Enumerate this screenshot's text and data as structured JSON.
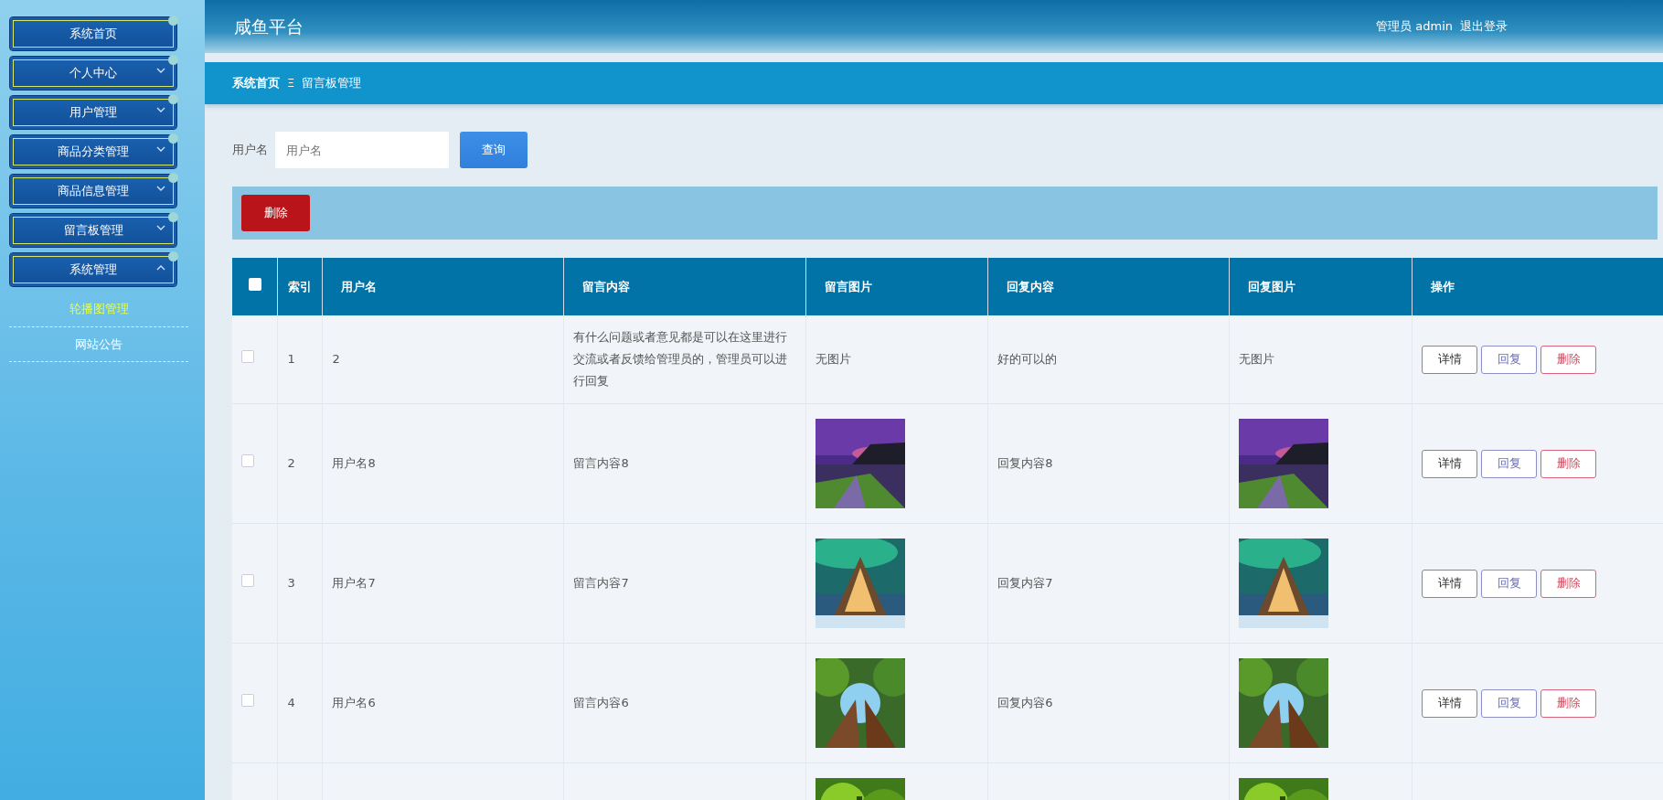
{
  "sidebar": {
    "items": [
      {
        "label": "系统首页",
        "kind": "link"
      },
      {
        "label": "个人中心",
        "kind": "group",
        "expanded": false
      },
      {
        "label": "用户管理",
        "kind": "group",
        "expanded": false
      },
      {
        "label": "商品分类管理",
        "kind": "group",
        "expanded": false
      },
      {
        "label": "商品信息管理",
        "kind": "group",
        "expanded": false
      },
      {
        "label": "留言板管理",
        "kind": "group",
        "expanded": false
      },
      {
        "label": "系统管理",
        "kind": "group",
        "expanded": true,
        "children": [
          {
            "label": "轮播图管理",
            "selected": true
          },
          {
            "label": "网站公告",
            "selected": false
          }
        ]
      }
    ]
  },
  "header": {
    "title": "咸鱼平台",
    "user": "管理员 admin",
    "logout": "退出登录"
  },
  "breadcrumb": {
    "items": [
      "系统首页",
      "留言板管理"
    ],
    "separator": "Ξ"
  },
  "search": {
    "label": "用户名",
    "placeholder": "用户名",
    "button": "查询"
  },
  "toolbar": {
    "delete_button": "删除"
  },
  "table": {
    "select_all_checked": false,
    "columns": [
      "索引",
      "用户名",
      "留言内容",
      "留言图片",
      "回复内容",
      "回复图片",
      "操作"
    ],
    "rows": [
      {
        "checked": false,
        "index": "1",
        "username": "2",
        "content": "有什么问题或者意见都是可以在这里进行交流或者反馈给管理员的，管理员可以进行回复",
        "message_image": {
          "kind": "text",
          "text": "无图片"
        },
        "reply": "好的可以的",
        "reply_image": {
          "kind": "text",
          "text": "无图片"
        },
        "actions": [
          "详情",
          "回复",
          "删除"
        ]
      },
      {
        "checked": false,
        "index": "2",
        "username": "用户名8",
        "content": "留言内容8",
        "message_image": {
          "kind": "picture"
        },
        "reply": "回复内容8",
        "reply_image": {
          "kind": "picture"
        },
        "actions": [
          "详情",
          "回复",
          "删除"
        ]
      },
      {
        "checked": false,
        "index": "3",
        "username": "用户名7",
        "content": "留言内容7",
        "message_image": {
          "kind": "picture"
        },
        "reply": "回复内容7",
        "reply_image": {
          "kind": "picture"
        },
        "actions": [
          "详情",
          "回复",
          "删除"
        ]
      },
      {
        "checked": false,
        "index": "4",
        "username": "用户名6",
        "content": "留言内容6",
        "message_image": {
          "kind": "picture"
        },
        "reply": "回复内容6",
        "reply_image": {
          "kind": "picture"
        },
        "actions": [
          "详情",
          "回复",
          "删除"
        ]
      },
      {
        "message_image": {
          "kind": "picture"
        },
        "reply_image": {
          "kind": "picture"
        }
      }
    ]
  }
}
